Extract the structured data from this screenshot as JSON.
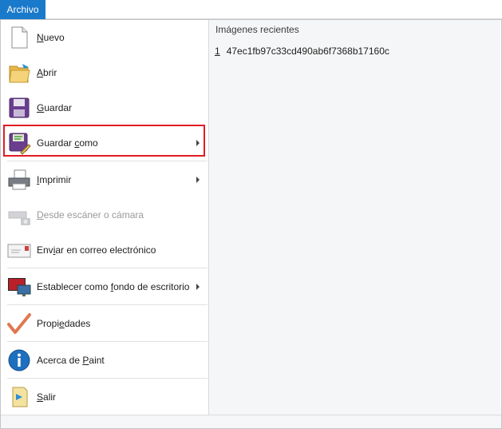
{
  "tab": {
    "label": "Archivo"
  },
  "menu": [
    {
      "id": "nuevo",
      "pre": "",
      "u": "N",
      "post": "uevo",
      "icon": "new-document-icon",
      "arrow": false,
      "disabled": false
    },
    {
      "id": "abrir",
      "pre": "",
      "u": "A",
      "post": "brir",
      "icon": "open-folder-icon",
      "arrow": false,
      "disabled": false
    },
    {
      "id": "guardar",
      "pre": "",
      "u": "G",
      "post": "uardar",
      "icon": "save-disk-icon",
      "arrow": false,
      "disabled": false
    },
    {
      "id": "guardar-como",
      "pre": "Guardar ",
      "u": "c",
      "post": "omo",
      "icon": "save-as-icon",
      "arrow": true,
      "disabled": false
    },
    {
      "id": "imprimir",
      "pre": "",
      "u": "I",
      "post": "mprimir",
      "icon": "printer-icon",
      "arrow": true,
      "disabled": false
    },
    {
      "id": "escaner",
      "pre": "",
      "u": "D",
      "post": "esde escáner o cámara",
      "icon": "scanner-camera-icon",
      "arrow": false,
      "disabled": true
    },
    {
      "id": "correo",
      "pre": "Env",
      "u": "i",
      "post": "ar en correo electrónico",
      "icon": "email-icon",
      "arrow": false,
      "disabled": false
    },
    {
      "id": "fondo",
      "pre": "Establecer como ",
      "u": "f",
      "post": "ondo de escritorio",
      "icon": "desktop-background-icon",
      "arrow": true,
      "disabled": false
    },
    {
      "id": "propiedades",
      "pre": "Propi",
      "u": "e",
      "post": "dades",
      "icon": "checkmark-icon",
      "arrow": false,
      "disabled": false
    },
    {
      "id": "acerca",
      "pre": "Acerca de ",
      "u": "P",
      "post": "aint",
      "icon": "info-icon",
      "arrow": false,
      "disabled": false
    },
    {
      "id": "salir",
      "pre": "",
      "u": "S",
      "post": "alir",
      "icon": "exit-icon",
      "arrow": false,
      "disabled": false
    }
  ],
  "recent": {
    "title": "Imágenes recientes",
    "items": [
      {
        "num": "1",
        "name": "47ec1fb97c33cd490ab6f7368b17160c"
      }
    ]
  }
}
